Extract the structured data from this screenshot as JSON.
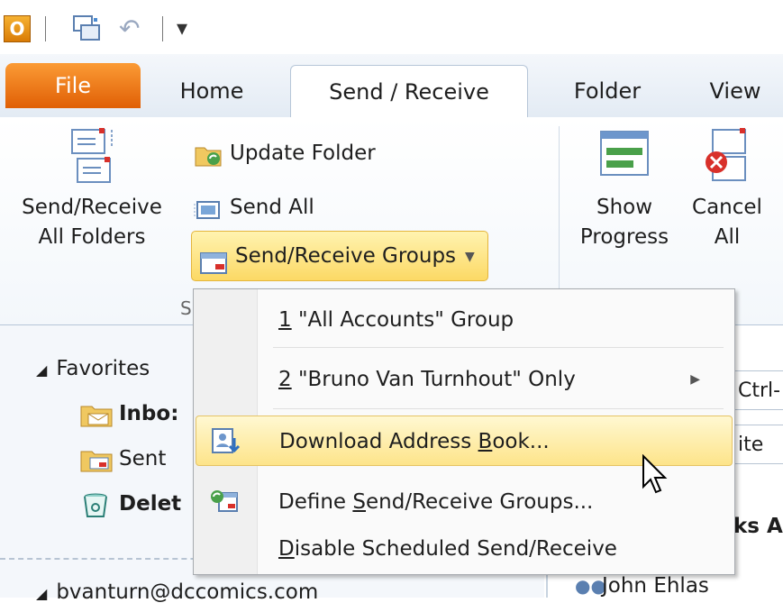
{
  "qat": {
    "logo_letter": "O",
    "customize_glyph": "▾"
  },
  "tabs": [
    {
      "label": "File"
    },
    {
      "label": "Home"
    },
    {
      "label": "Send / Receive"
    },
    {
      "label": "Folder"
    },
    {
      "label": "View"
    }
  ],
  "ribbon": {
    "send_receive_all_line1": "Send/Receive",
    "send_receive_all_line2": "All Folders",
    "update_folder": "Update Folder",
    "send_all": "Send All",
    "send_receive_groups": "Send/Receive Groups",
    "group_label_fragment": "S",
    "show_progress_line1": "Show",
    "show_progress_line2": "Progress",
    "cancel_all_line1": "Cancel",
    "cancel_all_line2": "All"
  },
  "menu": {
    "items": [
      {
        "accel": "1",
        "rest": " \"All Accounts\" Group"
      },
      {
        "accel": "2",
        "rest": " \"Bruno Van Turnhout\" Only"
      },
      {
        "pre": "Download Address ",
        "accel": "B",
        "post": "ook..."
      },
      {
        "pre": "Define ",
        "accel": "S",
        "post": "end/Receive Groups..."
      },
      {
        "pre": "",
        "accel": "D",
        "post": "isable Scheduled Send/Receive"
      }
    ]
  },
  "nav": {
    "favorites": "Favorites",
    "inbox": "Inbo:",
    "sent": "Sent",
    "deleted": "Delet",
    "account": "bvanturn@dccomics.com"
  },
  "right": {
    "search_fragment": "Ctrl-",
    "date_fragment": "ite",
    "header_fragment": "ks A",
    "contact": "John Ehlas"
  }
}
